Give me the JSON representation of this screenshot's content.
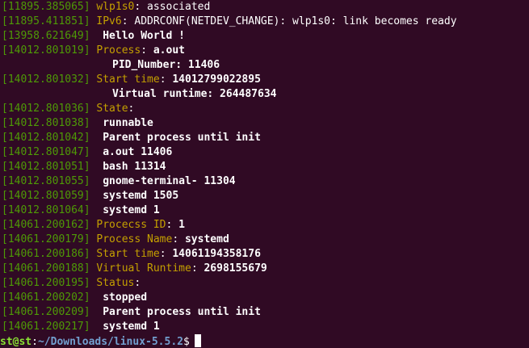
{
  "lines": [
    {
      "ts": "[11895.385065]",
      "label": "wlp1s0",
      "sep": ":",
      "value": " associated",
      "value_style": "plain"
    },
    {
      "ts": "[11895.411851]",
      "label": "IPv6",
      "sep": ":",
      "value": " ADDRCONF(NETDEV_CHANGE): wlp1s0: link becomes ready",
      "value_style": "plain"
    },
    {
      "ts": "[13958.621649]",
      "label": "",
      "sep": "",
      "value": " Hello World !",
      "value_style": "bold"
    },
    {
      "ts": "[14012.801019]",
      "label": "Process",
      "sep": ":",
      "value": " a.out",
      "value_style": "bold"
    },
    {
      "ts": "",
      "label": "",
      "sep": "",
      "value": "PID_Number: 11406",
      "value_style": "bold",
      "indent": true
    },
    {
      "ts": "[14012.801032]",
      "label": "Start time",
      "sep": ":",
      "value": " 14012799022895",
      "value_style": "bold"
    },
    {
      "ts": "",
      "label": "",
      "sep": "",
      "value": "Virtual runtime: 264487634",
      "value_style": "bold",
      "indent": true
    },
    {
      "ts": "[14012.801036]",
      "label": "State",
      "sep": ":",
      "value": "",
      "value_style": "bold"
    },
    {
      "ts": "[14012.801038]",
      "label": "",
      "sep": "",
      "value": " runnable",
      "value_style": "bold"
    },
    {
      "ts": "[14012.801042]",
      "label": "",
      "sep": "",
      "value": " Parent process until init",
      "value_style": "bold"
    },
    {
      "ts": "[14012.801047]",
      "label": "",
      "sep": "",
      "value": " a.out 11406",
      "value_style": "bold"
    },
    {
      "ts": "[14012.801051]",
      "label": "",
      "sep": "",
      "value": " bash 11314",
      "value_style": "bold"
    },
    {
      "ts": "[14012.801055]",
      "label": "",
      "sep": "",
      "value": " gnome-terminal- 11304",
      "value_style": "bold"
    },
    {
      "ts": "[14012.801059]",
      "label": "",
      "sep": "",
      "value": " systemd 1505",
      "value_style": "bold"
    },
    {
      "ts": "[14012.801064]",
      "label": "",
      "sep": "",
      "value": " systemd 1",
      "value_style": "bold"
    },
    {
      "ts": "[14061.200162]",
      "label": "Procecss ID",
      "sep": ":",
      "value": " 1",
      "value_style": "bold"
    },
    {
      "ts": "[14061.200179]",
      "label": "Process Name",
      "sep": ":",
      "value": " systemd",
      "value_style": "bold"
    },
    {
      "ts": "[14061.200186]",
      "label": "Start time",
      "sep": ":",
      "value": " 14061194358176",
      "value_style": "bold"
    },
    {
      "ts": "[14061.200188]",
      "label": "Virtual Runtime",
      "sep": ":",
      "value": " 2698155679",
      "value_style": "bold"
    },
    {
      "ts": "[14061.200195]",
      "label": "Status",
      "sep": ":",
      "value": "",
      "value_style": "bold"
    },
    {
      "ts": "[14061.200202]",
      "label": "",
      "sep": "",
      "value": " stopped",
      "value_style": "bold"
    },
    {
      "ts": "[14061.200209]",
      "label": "",
      "sep": "",
      "value": " Parent process until init",
      "value_style": "bold"
    },
    {
      "ts": "[14061.200217]",
      "label": "",
      "sep": "",
      "value": " systemd 1",
      "value_style": "bold"
    }
  ],
  "prompt": {
    "user_host": "st@st",
    "colon": ":",
    "path": "~/Downloads/linux-5.5.2",
    "symbol": "$"
  },
  "colors": {
    "background": "#300a24",
    "timestamp": "#4e9a06",
    "label": "#c4a000",
    "text": "#ffffff",
    "prompt_user": "#8ae234",
    "prompt_path": "#729fcf"
  }
}
